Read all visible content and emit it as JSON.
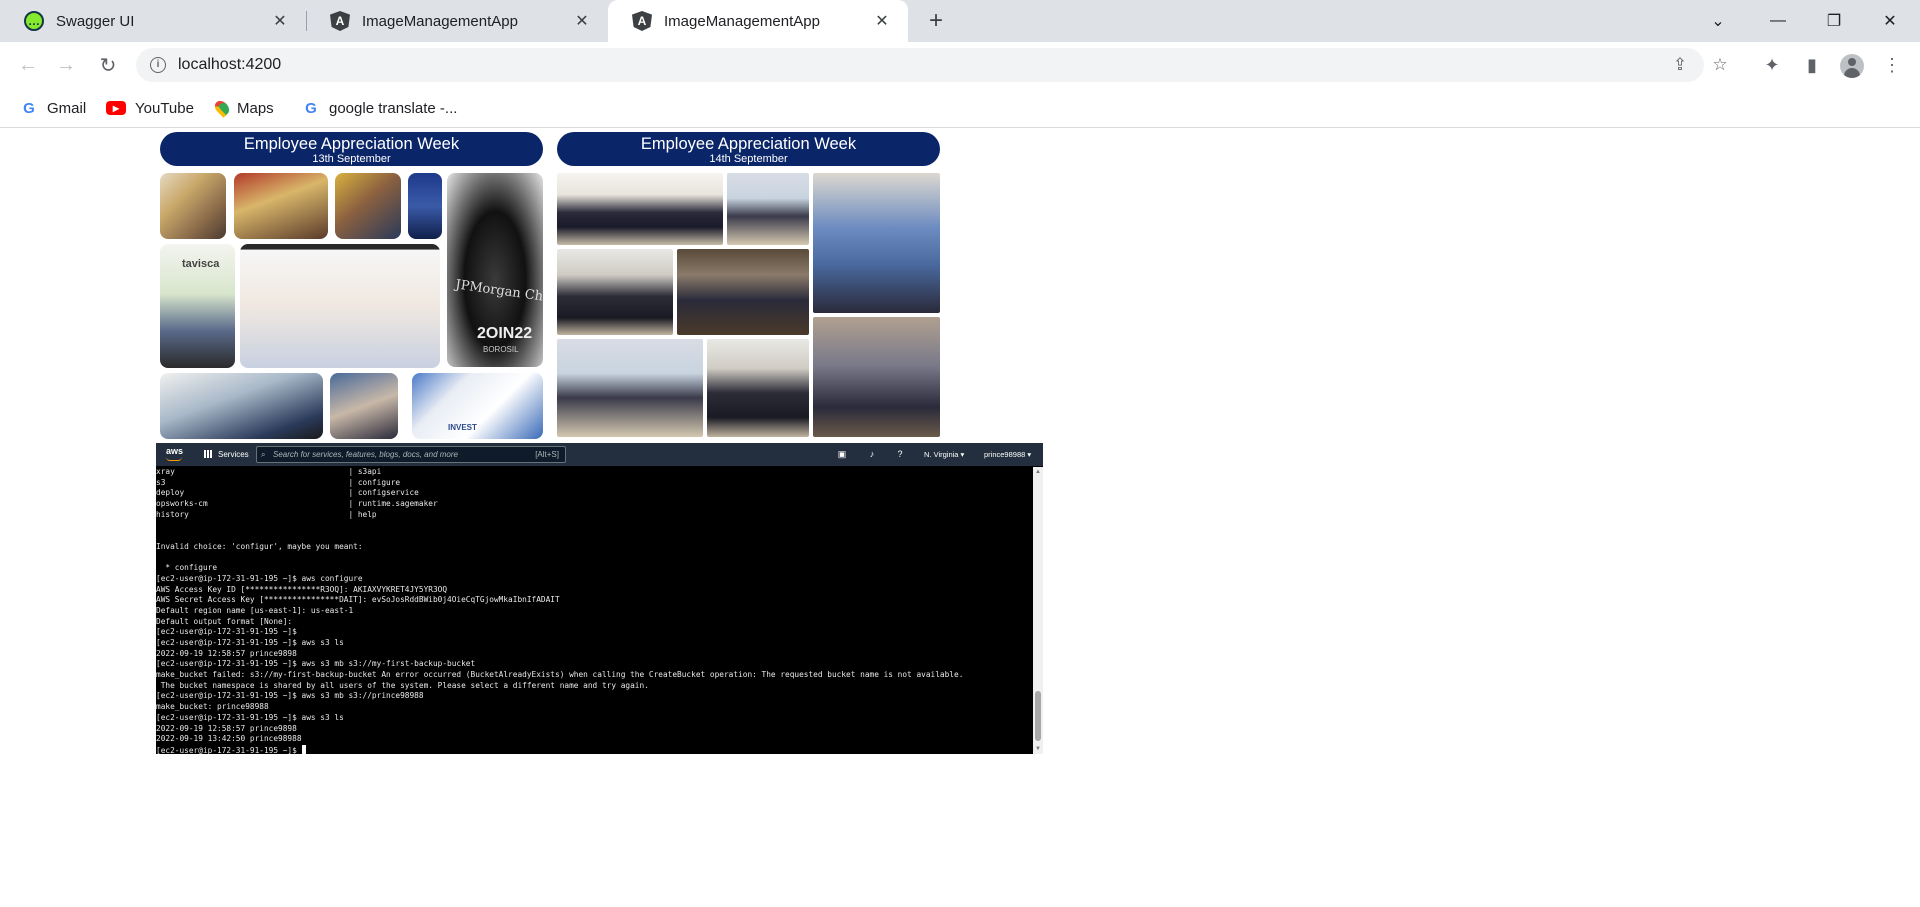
{
  "browser": {
    "tabs": [
      {
        "title": "Swagger UI",
        "icon": "swagger-icon",
        "active": false
      },
      {
        "title": "ImageManagementApp",
        "icon": "angular-icon",
        "active": false
      },
      {
        "title": "ImageManagementApp",
        "icon": "angular-icon",
        "active": true
      }
    ],
    "new_tab_label": "+",
    "url": "localhost:4200",
    "bookmarks": [
      {
        "label": "Gmail",
        "icon": "google-icon"
      },
      {
        "label": "YouTube",
        "icon": "youtube-icon"
      },
      {
        "label": "Maps",
        "icon": "maps-icon"
      },
      {
        "label": "google translate -...",
        "icon": "google-icon"
      }
    ]
  },
  "page": {
    "banners": [
      {
        "title": "Employee Appreciation Week",
        "subtitle": "13th September"
      },
      {
        "title": "Employee Appreciation Week",
        "subtitle": "14th September"
      }
    ],
    "collage_text": {
      "tavisca": "tavisca",
      "mug_brand": "JPMorgan Chase",
      "mug_year": "2OIN22",
      "mug_sub": "BOROSIL",
      "invest": "INVEST"
    }
  },
  "aws_console": {
    "logo": "aws",
    "services_label": "Services",
    "search_placeholder": "Search for services, features, blogs, docs, and more",
    "search_shortcut": "[Alt+S]",
    "region": "N. Virginia ▾",
    "user": "prince98988 ▾",
    "terminal_lines": [
      "xray                                     | s3api",
      "s3                                       | configure",
      "deploy                                   | configservice",
      "opsworks-cm                              | runtime.sagemaker",
      "history                                  | help",
      "",
      "",
      "Invalid choice: 'configur', maybe you meant:",
      "",
      "  * configure",
      "[ec2-user@ip-172-31-91-195 ~]$ aws configure",
      "AWS Access Key ID [****************R3OQ]: AKIAXVYKRET4JY5YR3OQ",
      "AWS Secret Access Key [****************DAIT]: 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",
      "Default region name [us-east-1]: us-east-1",
      "Default output format [None]:",
      "[ec2-user@ip-172-31-91-195 ~]$",
      "[ec2-user@ip-172-31-91-195 ~]$ aws s3 ls",
      "2022-09-19 12:58:57 prince9898",
      "[ec2-user@ip-172-31-91-195 ~]$ aws s3 mb s3://my-first-backup-bucket",
      "make_bucket failed: s3://my-first-backup-bucket An error occurred (BucketAlreadyExists) when calling the CreateBucket operation: The requested bucket name is not available.",
      " The bucket namespace is shared by all users of the system. Please select a different name and try again.",
      "[ec2-user@ip-172-31-91-195 ~]$ aws s3 mb s3://prince98988",
      "make_bucket: prince98988",
      "[ec2-user@ip-172-31-91-195 ~]$ aws s3 ls",
      "2022-09-19 12:58:57 prince9898",
      "2022-09-19 13:42:50 prince98988"
    ],
    "prompt_line": "[ec2-user@ip-172-31-91-195 ~]$ "
  }
}
